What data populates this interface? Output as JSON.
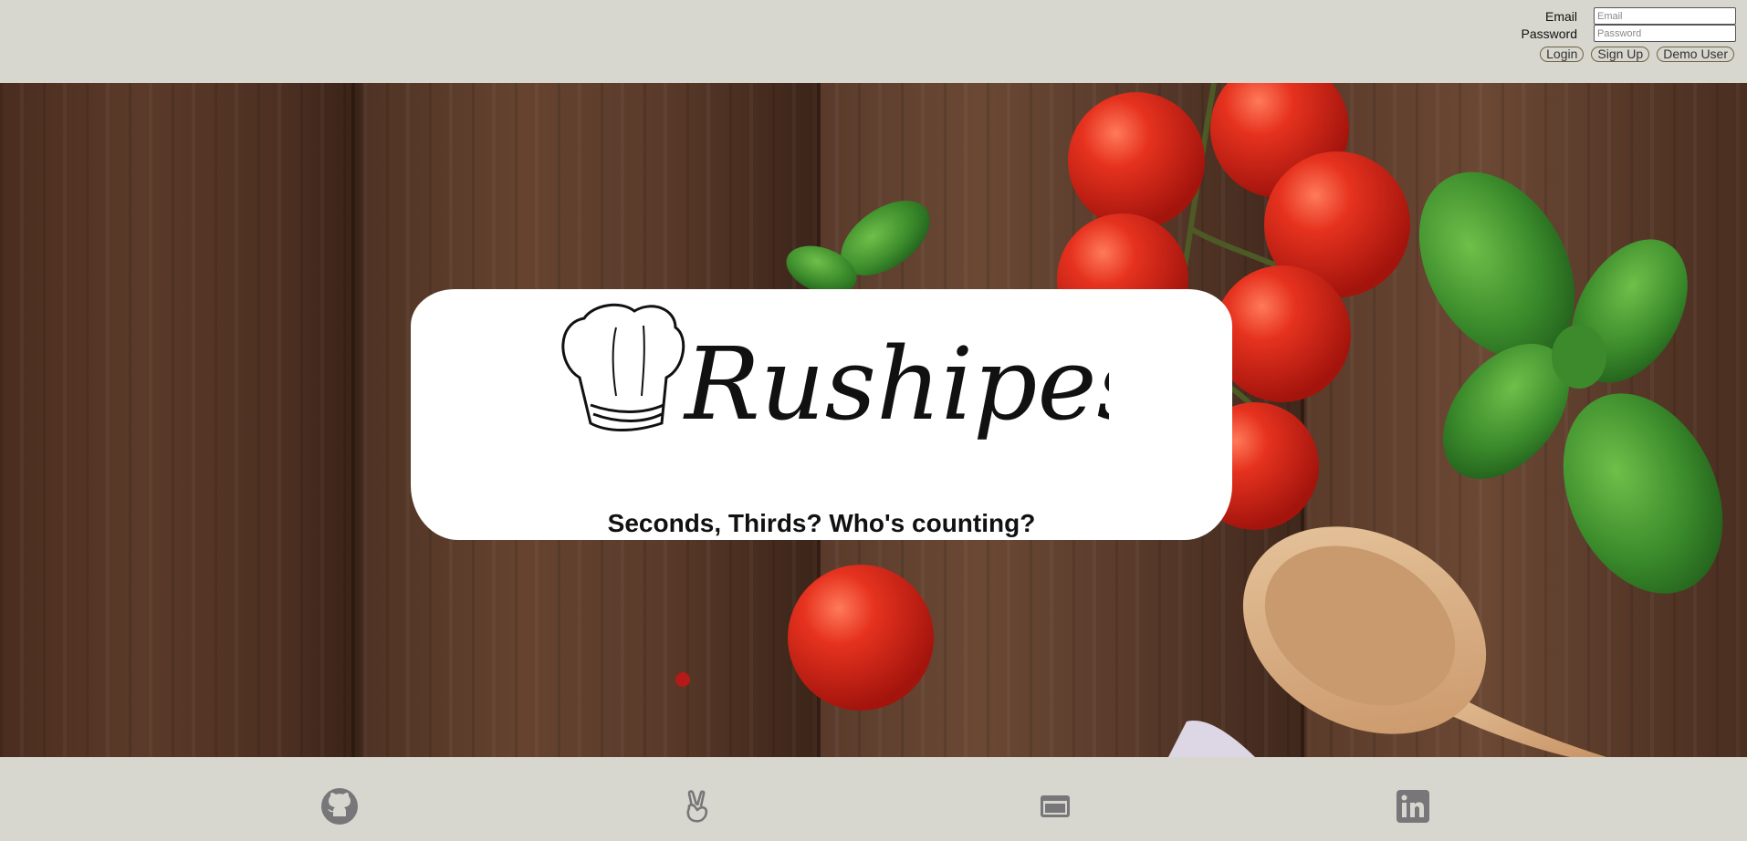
{
  "login": {
    "email_label": "Email",
    "email_placeholder": "Email",
    "password_label": "Password",
    "password_placeholder": "Password",
    "buttons": {
      "login": "Login",
      "signup": "Sign Up",
      "demo": "Demo User"
    }
  },
  "hero": {
    "logo_text": "Rushipes",
    "tagline": "Seconds, Thirds? Who's counting?"
  },
  "footer": {
    "icons": [
      "github-icon",
      "angellist-icon",
      "portfolio-icon",
      "linkedin-icon"
    ]
  },
  "colors": {
    "header_bg": "#d8d7cf",
    "button_border": "#6e6441",
    "icon_gray": "#77777a",
    "wood_dark": "#4a2d1f",
    "tomato_red": "#e0271c",
    "basil_green": "#3c8a2d"
  }
}
